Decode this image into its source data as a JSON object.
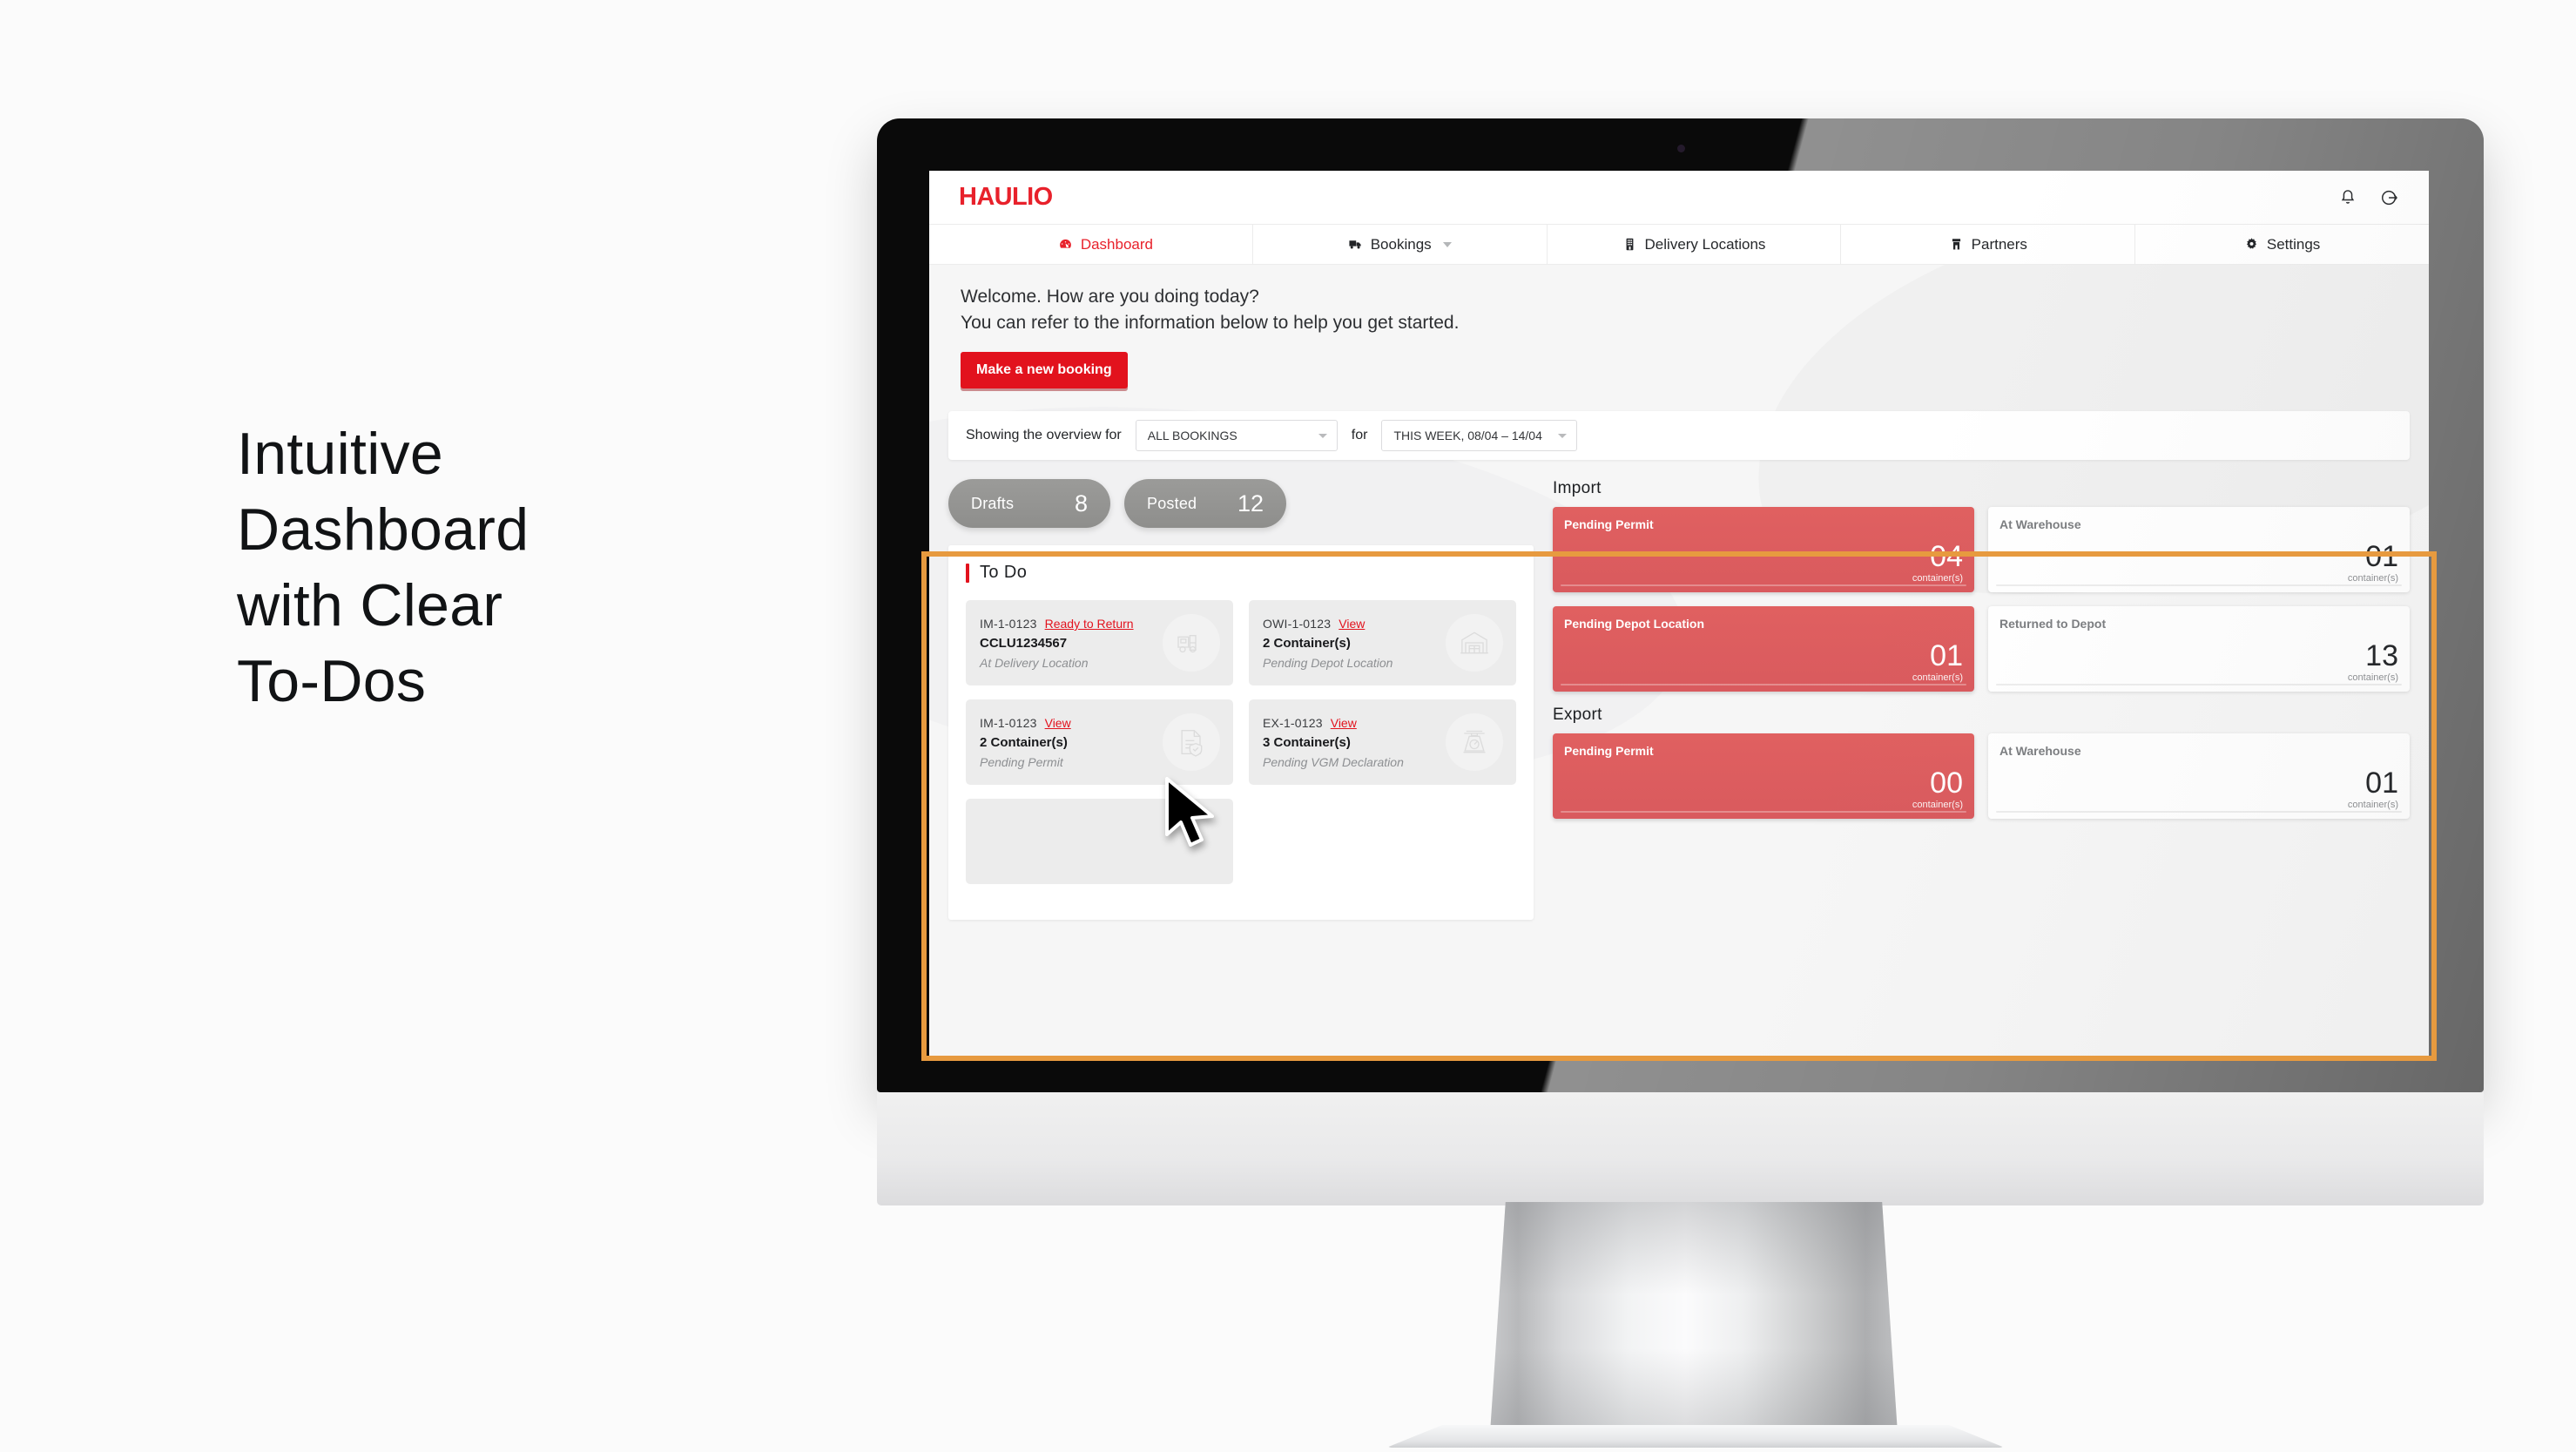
{
  "promo": {
    "headline": "Intuitive\nDashboard\nwith Clear\nTo-Dos"
  },
  "app": {
    "logo": "HAULIO",
    "topbar_icons": [
      "bell-icon",
      "logout-icon"
    ],
    "nav": [
      {
        "label": "Dashboard",
        "icon": "speedometer-icon",
        "active": true,
        "caret": false
      },
      {
        "label": "Bookings",
        "icon": "truck-icon",
        "active": false,
        "caret": true
      },
      {
        "label": "Delivery Locations",
        "icon": "building-icon",
        "active": false,
        "caret": false
      },
      {
        "label": "Partners",
        "icon": "warehouse-icon",
        "active": false,
        "caret": false
      },
      {
        "label": "Settings",
        "icon": "gear-icon",
        "active": false,
        "caret": false
      }
    ],
    "welcome": {
      "line1": "Welcome. How are you doing today?",
      "line2": "You can refer to the information below to help you get started.",
      "cta": "Make a new booking"
    },
    "filter": {
      "prefix": "Showing the overview for",
      "bookings_value": "ALL BOOKINGS",
      "joiner": "for",
      "period_value": "THIS WEEK, 08/04 – 14/04"
    },
    "pills": [
      {
        "label": "Drafts",
        "value": "8"
      },
      {
        "label": "Posted",
        "value": "12"
      }
    ],
    "todo": {
      "title": "To Do",
      "cards": [
        {
          "ref": "IM-1-0123",
          "action": "Ready to Return",
          "count": "CCLU1234567",
          "status": "At Delivery Location",
          "icon": "truck-icon"
        },
        {
          "ref": "OWI-1-0123",
          "action": "View",
          "count": "2 Container(s)",
          "status": "Pending Depot Location",
          "icon": "warehouse-icon"
        },
        {
          "ref": "IM-1-0123",
          "action": "View",
          "count": "2 Container(s)",
          "status": "Pending Permit",
          "icon": "permit-document-icon"
        },
        {
          "ref": "EX-1-0123",
          "action": "View",
          "count": "3 Container(s)",
          "status": "Pending VGM Declaration",
          "icon": "weighing-scale-icon"
        }
      ]
    },
    "sections": [
      {
        "title": "Import",
        "rows": [
          [
            {
              "label": "Pending Permit",
              "value": "04",
              "unit": "container(s)",
              "highlight": true
            },
            {
              "label": "At Warehouse",
              "value": "01",
              "unit": "container(s)",
              "highlight": false
            }
          ],
          [
            {
              "label": "Pending Depot Location",
              "value": "01",
              "unit": "container(s)",
              "highlight": true
            },
            {
              "label": "Returned to Depot",
              "value": "13",
              "unit": "container(s)",
              "highlight": false
            }
          ]
        ]
      },
      {
        "title": "Export",
        "rows": [
          [
            {
              "label": "Pending Permit",
              "value": "00",
              "unit": "container(s)",
              "highlight": true
            },
            {
              "label": "At Warehouse",
              "value": "01",
              "unit": "container(s)",
              "highlight": false
            }
          ]
        ]
      }
    ],
    "colors": {
      "brand_red": "#e2121d",
      "stat_red": "#d95a5e",
      "highlight_orange": "#e79a3f",
      "pill_grey": "#949492"
    }
  }
}
